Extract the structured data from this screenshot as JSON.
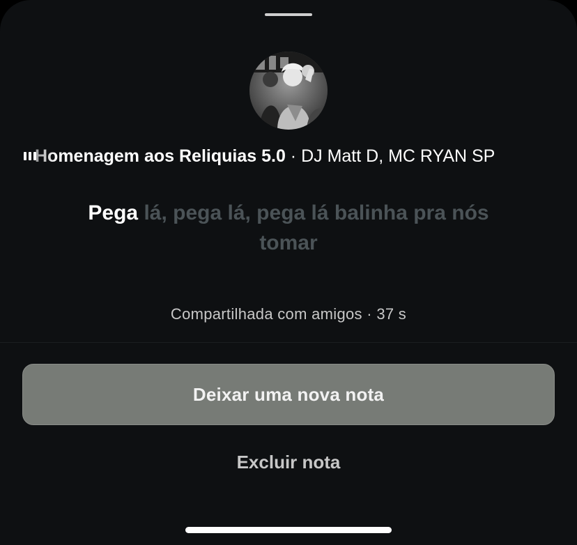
{
  "note": {
    "track_title": "Homenagem aos Reliquias 5.0",
    "track_separator": " · ",
    "track_artists": "DJ Matt D, MC RYAN SP",
    "lyric_active": "Pega",
    "lyric_rest": " lá, pega lá, pega lá balinha pra nós tomar",
    "audience": "Compartilhada com amigos",
    "meta_separator": " · ",
    "age": "37 s"
  },
  "actions": {
    "new_note_label": "Deixar uma nova nota",
    "delete_note_label": "Excluir nota"
  },
  "icons": {
    "now_playing": "equalizer-bars-icon",
    "avatar": "profile-photo"
  },
  "colors": {
    "sheet_background": "#0e1012",
    "primary_button": "#777b76",
    "lyric_inactive": "#4b5357"
  }
}
